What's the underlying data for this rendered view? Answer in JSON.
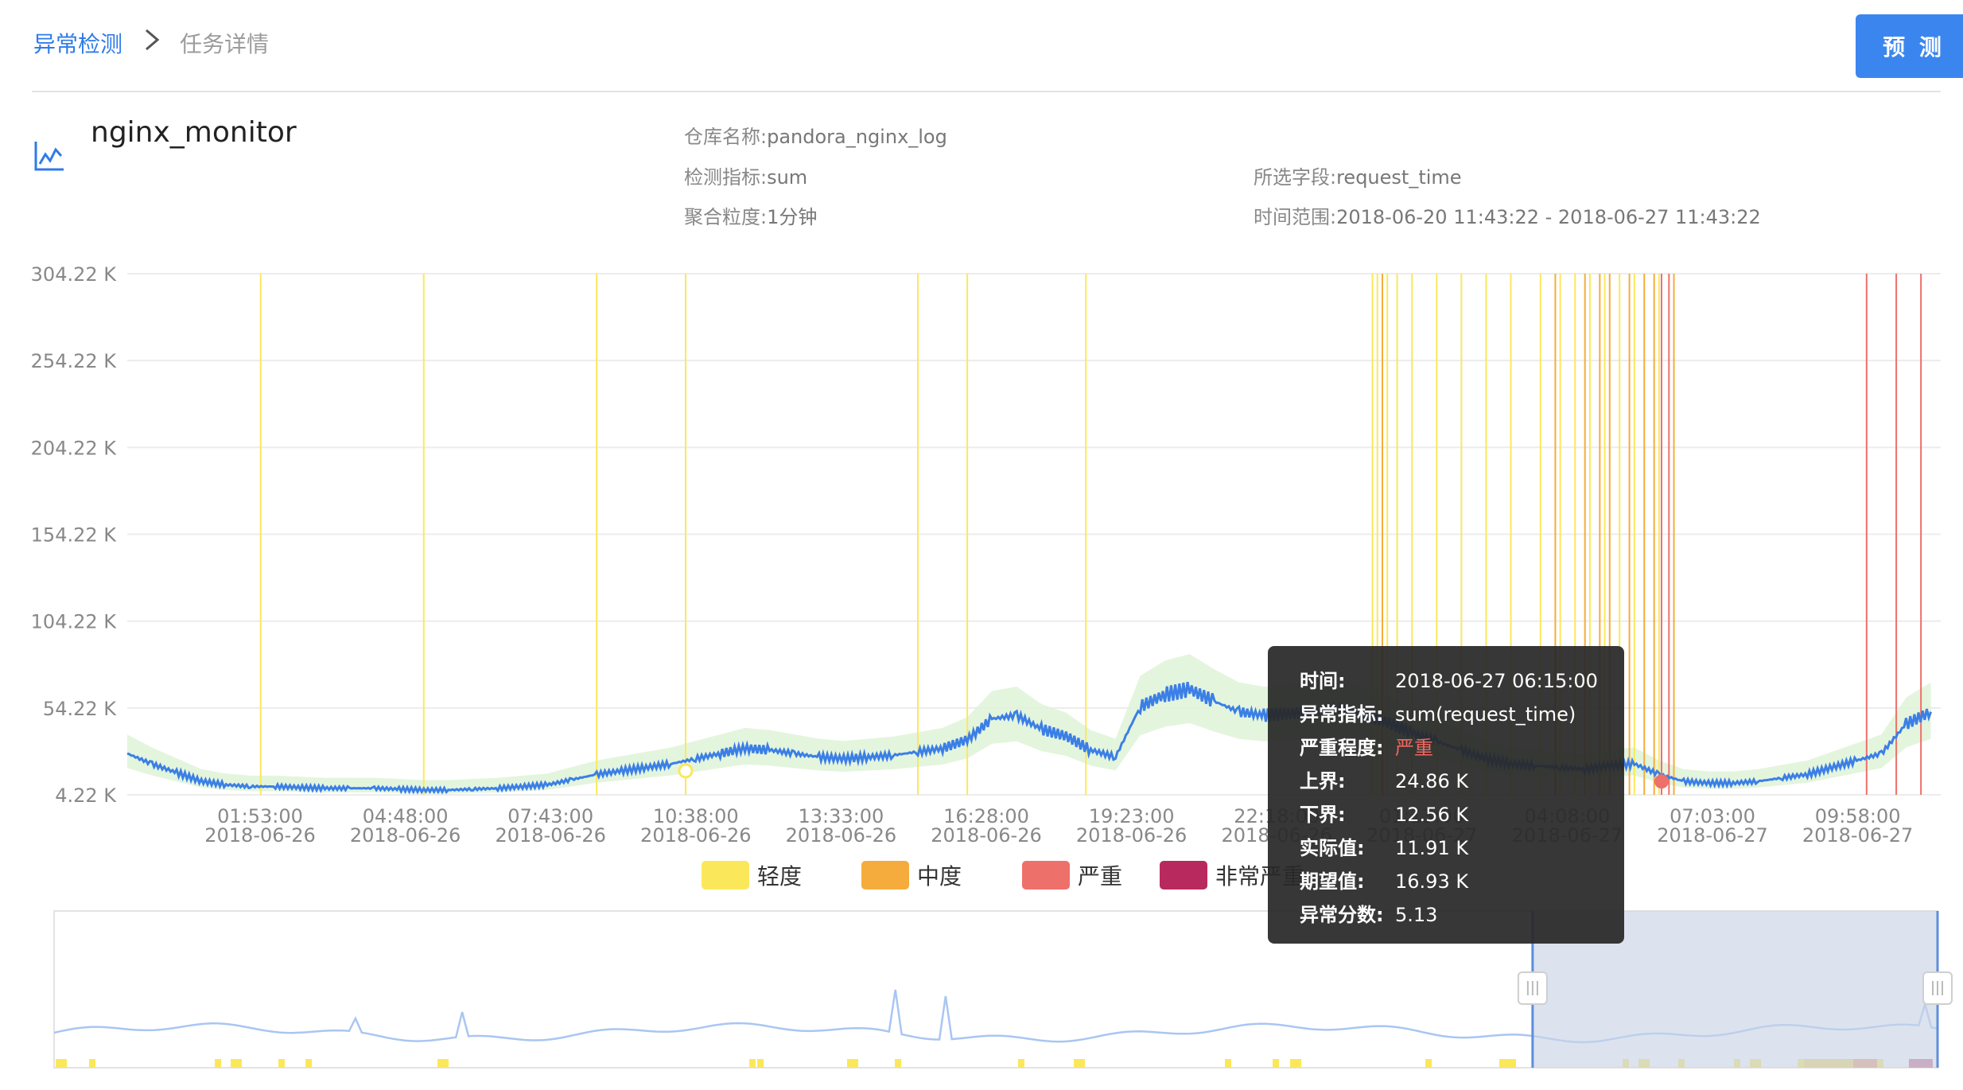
{
  "breadcrumb": {
    "home": "异常检测",
    "current": "任务详情"
  },
  "actions": {
    "predict_label": "预 测"
  },
  "task": {
    "name": "nginx_monitor",
    "repo_label": "仓库名称:",
    "repo_value": "pandora_nginx_log",
    "metric_label": "检测指标:",
    "metric_value": "sum",
    "field_label": "所选字段:",
    "field_value": "request_time",
    "granularity_label": "聚合粒度:",
    "granularity_value": "1分钟",
    "range_label": "时间范围:",
    "range_value": "2018-06-20 11:43:22 - 2018-06-27 11:43:22"
  },
  "legend": [
    {
      "label": "轻度",
      "color": "#fbe85a"
    },
    {
      "label": "中度",
      "color": "#f5ac3c"
    },
    {
      "label": "严重",
      "color": "#ee706a"
    },
    {
      "label": "非常严重",
      "color": "#b82a5e"
    }
  ],
  "chart_data": {
    "type": "line",
    "y_ticks": [
      "304.22 K",
      "254.22 K",
      "204.22 K",
      "154.22 K",
      "104.22 K",
      "54.22 K",
      "4.22 K"
    ],
    "ylim": [
      4.22,
      304.22
    ],
    "y_unit": "K",
    "x_ticks": [
      {
        "time": "01:53:00",
        "date": "2018-06-26"
      },
      {
        "time": "04:48:00",
        "date": "2018-06-26"
      },
      {
        "time": "07:43:00",
        "date": "2018-06-26"
      },
      {
        "time": "10:38:00",
        "date": "2018-06-26"
      },
      {
        "time": "13:33:00",
        "date": "2018-06-26"
      },
      {
        "time": "16:28:00",
        "date": "2018-06-26"
      },
      {
        "time": "19:23:00",
        "date": "2018-06-26"
      },
      {
        "time": "22:18:00",
        "date": "2018-06-26"
      },
      {
        "time": "01:13:00",
        "date": "2018-06-27"
      },
      {
        "time": "04:08:00",
        "date": "2018-06-27"
      },
      {
        "time": "07:03:00",
        "date": "2018-06-27"
      },
      {
        "time": "09:58:00",
        "date": "2018-06-27"
      }
    ],
    "series": [
      {
        "name": "实际值",
        "color": "#3b7fe6",
        "x_hours": [
          0,
          0.5,
          1,
          1.5,
          2,
          2.5,
          3,
          3.5,
          4,
          4.5,
          5,
          5.5,
          6,
          6.5,
          7,
          7.5,
          8,
          8.5,
          9,
          9.5,
          10,
          10.5,
          11,
          11.5,
          12,
          12.5,
          13,
          13.5,
          14,
          14.5,
          15,
          15.5,
          16,
          16.5,
          17,
          17.5,
          18,
          18.5,
          19,
          19.5,
          20,
          20.5,
          21,
          21.5,
          22,
          22.5,
          23,
          23.5,
          24,
          24.5,
          25,
          25.5,
          26,
          26.5,
          27,
          27.5,
          28,
          28.5,
          29,
          29.5,
          30,
          30.5,
          31,
          31.5,
          32,
          32.5,
          33,
          33.5,
          34,
          34.5,
          35,
          35.5,
          36,
          36.5
        ],
        "values": [
          28,
          22,
          17,
          12,
          10,
          9,
          9,
          8.5,
          8,
          8,
          8,
          7.5,
          7,
          7,
          7.5,
          8,
          9,
          10,
          13,
          16,
          18,
          20,
          22,
          25,
          28,
          31,
          30,
          28,
          26,
          25,
          26,
          27,
          29,
          31,
          36,
          48,
          50,
          42,
          38,
          30,
          26,
          55,
          62,
          65,
          58,
          52,
          50,
          51,
          52,
          54,
          50,
          46,
          40,
          35,
          30,
          25,
          22,
          21,
          20,
          19,
          21,
          22,
          16,
          12,
          11,
          11,
          12,
          14,
          16,
          20,
          24,
          28,
          45,
          52
        ]
      }
    ],
    "band": {
      "name": "期望区间",
      "color": "#dff3d8"
    },
    "anomalies": {
      "mild_x_hours": [
        2.7,
        6.0,
        9.5,
        11.3,
        16.0,
        17.0,
        19.4,
        25.2,
        25.3,
        25.5,
        25.7,
        26.0,
        26.5,
        27.0,
        27.5,
        28.0,
        28.6,
        29.0,
        29.3,
        29.6,
        29.9,
        30.2,
        30.5,
        31.0
      ],
      "moderate_x_hours": [
        25.4,
        28.9,
        29.5,
        29.8,
        30.0,
        30.4,
        30.7,
        30.9,
        31.3
      ],
      "severe_x_hours": [
        31.05,
        31.2,
        35.2,
        35.8,
        36.3
      ],
      "highlight_mild": 11.3,
      "highlight_severe": 31.05
    }
  },
  "tooltip": {
    "time_label": "时间:",
    "time_value": "2018-06-27 06:15:00",
    "metric_label": "异常指标:",
    "metric_value": "sum(request_time)",
    "severity_label": "严重程度:",
    "severity_value": "严重",
    "upper_label": "上界:",
    "upper_value": "24.86 K",
    "lower_label": "下界:",
    "lower_value": "12.56 K",
    "actual_label": "实际值:",
    "actual_value": "11.91 K",
    "expected_label": "期望值:",
    "expected_value": "16.93 K",
    "score_label": "异常分数:",
    "score_value": "5.13"
  },
  "navigator": {
    "selection_start_fraction": 0.785,
    "selection_end_fraction": 1.0
  },
  "colors": {
    "accent": "#2f7be8",
    "line": "#3b7fe6",
    "band": "#dff3d8",
    "selection": "#d7dfeb"
  }
}
